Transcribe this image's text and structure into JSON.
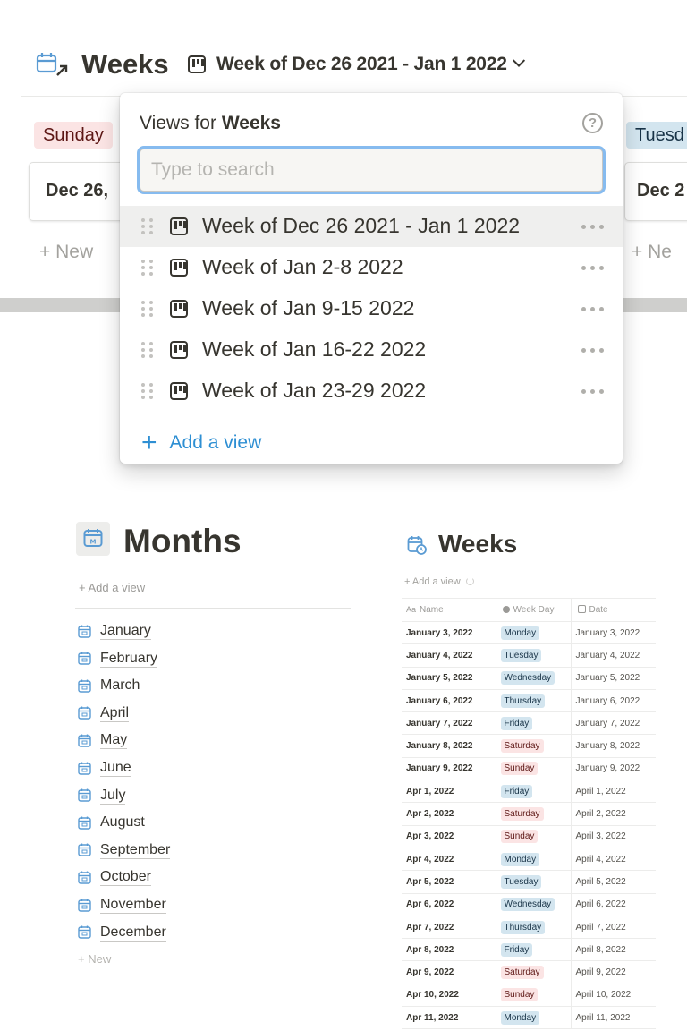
{
  "header": {
    "title": "Weeks",
    "current_view": "Week of Dec 26 2021 - Jan 1 2022"
  },
  "board": {
    "left_column_tag": "Sunday",
    "left_card": "Dec 26,",
    "right_column_tag": "Tuesd",
    "right_card": "Dec 2",
    "new_label_left": "+ New",
    "new_label_right": "+ Ne"
  },
  "popup": {
    "title_prefix": "Views for ",
    "title_db": "Weeks",
    "help_glyph": "?",
    "search_placeholder": "Type to search",
    "views": [
      {
        "label": "Week of Dec 26 2021 - Jan 1 2022",
        "active": true
      },
      {
        "label": "Week of Jan 2-8 2022",
        "active": false
      },
      {
        "label": "Week of Jan 9-15 2022",
        "active": false
      },
      {
        "label": "Week of Jan 16-22 2022",
        "active": false
      },
      {
        "label": "Week of Jan 23-29 2022",
        "active": false
      }
    ],
    "add_view_label": "Add a view"
  },
  "months": {
    "title": "Months",
    "add_view": "+ Add a view",
    "items": [
      "January",
      "February",
      "March",
      "April",
      "May",
      "June",
      "July",
      "August",
      "September",
      "October",
      "November",
      "December"
    ],
    "new_label": "+ New"
  },
  "weeks_table": {
    "title": "Weeks",
    "add_view": "+ Add a view",
    "columns": [
      "Name",
      "Week Day",
      "Date"
    ],
    "rows": [
      {
        "name": "January 3, 2022",
        "day": "Monday",
        "date": "January 3, 2022"
      },
      {
        "name": "January 4, 2022",
        "day": "Tuesday",
        "date": "January 4, 2022"
      },
      {
        "name": "January 5, 2022",
        "day": "Wednesday",
        "date": "January 5, 2022"
      },
      {
        "name": "January 6, 2022",
        "day": "Thursday",
        "date": "January 6, 2022"
      },
      {
        "name": "January 7, 2022",
        "day": "Friday",
        "date": "January 7, 2022"
      },
      {
        "name": "January 8, 2022",
        "day": "Saturday",
        "date": "January 8, 2022"
      },
      {
        "name": "January 9, 2022",
        "day": "Sunday",
        "date": "January 9, 2022"
      },
      {
        "name": "Apr 1, 2022",
        "day": "Friday",
        "date": "April 1, 2022"
      },
      {
        "name": "Apr 2, 2022",
        "day": "Saturday",
        "date": "April 2, 2022"
      },
      {
        "name": "Apr 3, 2022",
        "day": "Sunday",
        "date": "April 3, 2022"
      },
      {
        "name": "Apr 4, 2022",
        "day": "Monday",
        "date": "April 4, 2022"
      },
      {
        "name": "Apr 5, 2022",
        "day": "Tuesday",
        "date": "April 5, 2022"
      },
      {
        "name": "Apr 6, 2022",
        "day": "Wednesday",
        "date": "April 6, 2022"
      },
      {
        "name": "Apr 7, 2022",
        "day": "Thursday",
        "date": "April 7, 2022"
      },
      {
        "name": "Apr 8, 2022",
        "day": "Friday",
        "date": "April 8, 2022"
      },
      {
        "name": "Apr 9, 2022",
        "day": "Saturday",
        "date": "April 9, 2022"
      },
      {
        "name": "Apr 10, 2022",
        "day": "Sunday",
        "date": "April 10, 2022"
      },
      {
        "name": "Apr 11, 2022",
        "day": "Monday",
        "date": "April 11, 2022"
      }
    ]
  },
  "colors": {
    "accent_blue": "#2e8fd3",
    "calendar_icon": "#5a9bd3",
    "pill_blue_bg": "#d3e5ef",
    "pill_blue_fg": "#183347",
    "pill_red_bg": "#fbe4e4",
    "pill_red_fg": "#5d1715"
  }
}
